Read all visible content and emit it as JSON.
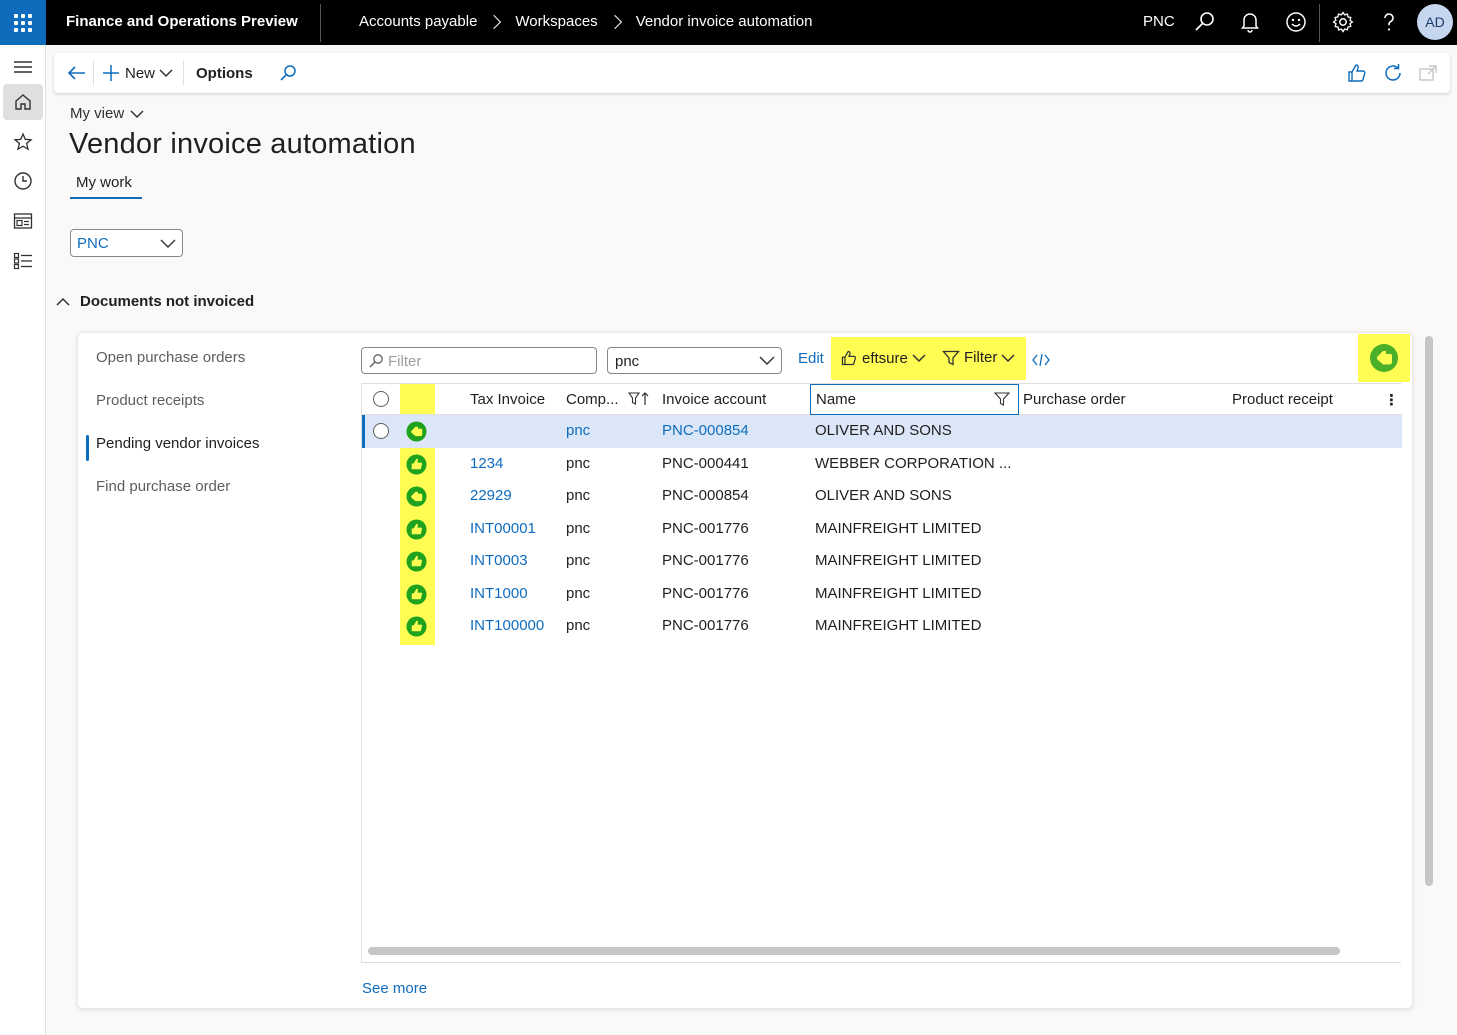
{
  "topbar": {
    "app_title": "Finance and Operations Preview",
    "breadcrumbs": [
      "Accounts payable",
      "Workspaces",
      "Vendor invoice automation"
    ],
    "company": "PNC",
    "avatar_initials": "AD"
  },
  "actionpane": {
    "new_label": "New",
    "options_label": "Options"
  },
  "header": {
    "view_label": "My view",
    "title": "Vendor invoice automation",
    "tab_label": "My work"
  },
  "company_filter": {
    "value": "PNC"
  },
  "section": {
    "title": "Documents not invoiced"
  },
  "nav": {
    "items": [
      {
        "label": "Open purchase orders"
      },
      {
        "label": "Product receipts"
      },
      {
        "label": "Pending vendor invoices"
      },
      {
        "label": "Find purchase order"
      }
    ]
  },
  "grid_toolbar": {
    "filter_placeholder": "Filter",
    "company_value": "pnc",
    "edit_label": "Edit",
    "eftsure_label": "eftsure",
    "filter_label": "Filter"
  },
  "grid": {
    "columns": [
      "Tax Invoice",
      "Comp...",
      "Invoice account",
      "Name",
      "Purchase order",
      "Product receipt"
    ],
    "rows": [
      {
        "tax_invoice": "",
        "company": "pnc",
        "account": "PNC-000854",
        "name": "OLIVER AND SONS",
        "status": "pointing"
      },
      {
        "tax_invoice": "1234",
        "company": "pnc",
        "account": "PNC-000441",
        "name": "WEBBER CORPORATION ...",
        "status": "thumbs-up"
      },
      {
        "tax_invoice": "22929",
        "company": "pnc",
        "account": "PNC-000854",
        "name": "OLIVER AND SONS",
        "status": "pointing"
      },
      {
        "tax_invoice": "INT00001",
        "company": "pnc",
        "account": "PNC-001776",
        "name": "MAINFREIGHT LIMITED",
        "status": "thumbs-up"
      },
      {
        "tax_invoice": "INT0003",
        "company": "pnc",
        "account": "PNC-001776",
        "name": "MAINFREIGHT LIMITED",
        "status": "thumbs-up"
      },
      {
        "tax_invoice": "INT1000",
        "company": "pnc",
        "account": "PNC-001776",
        "name": "MAINFREIGHT LIMITED",
        "status": "thumbs-up"
      },
      {
        "tax_invoice": "INT100000",
        "company": "pnc",
        "account": "PNC-001776",
        "name": "MAINFREIGHT LIMITED",
        "status": "thumbs-up"
      }
    ],
    "see_more": "See more"
  },
  "colors": {
    "accent": "#0f6cbd",
    "highlight": "#fffd54",
    "status_green": "#1fa31f"
  }
}
